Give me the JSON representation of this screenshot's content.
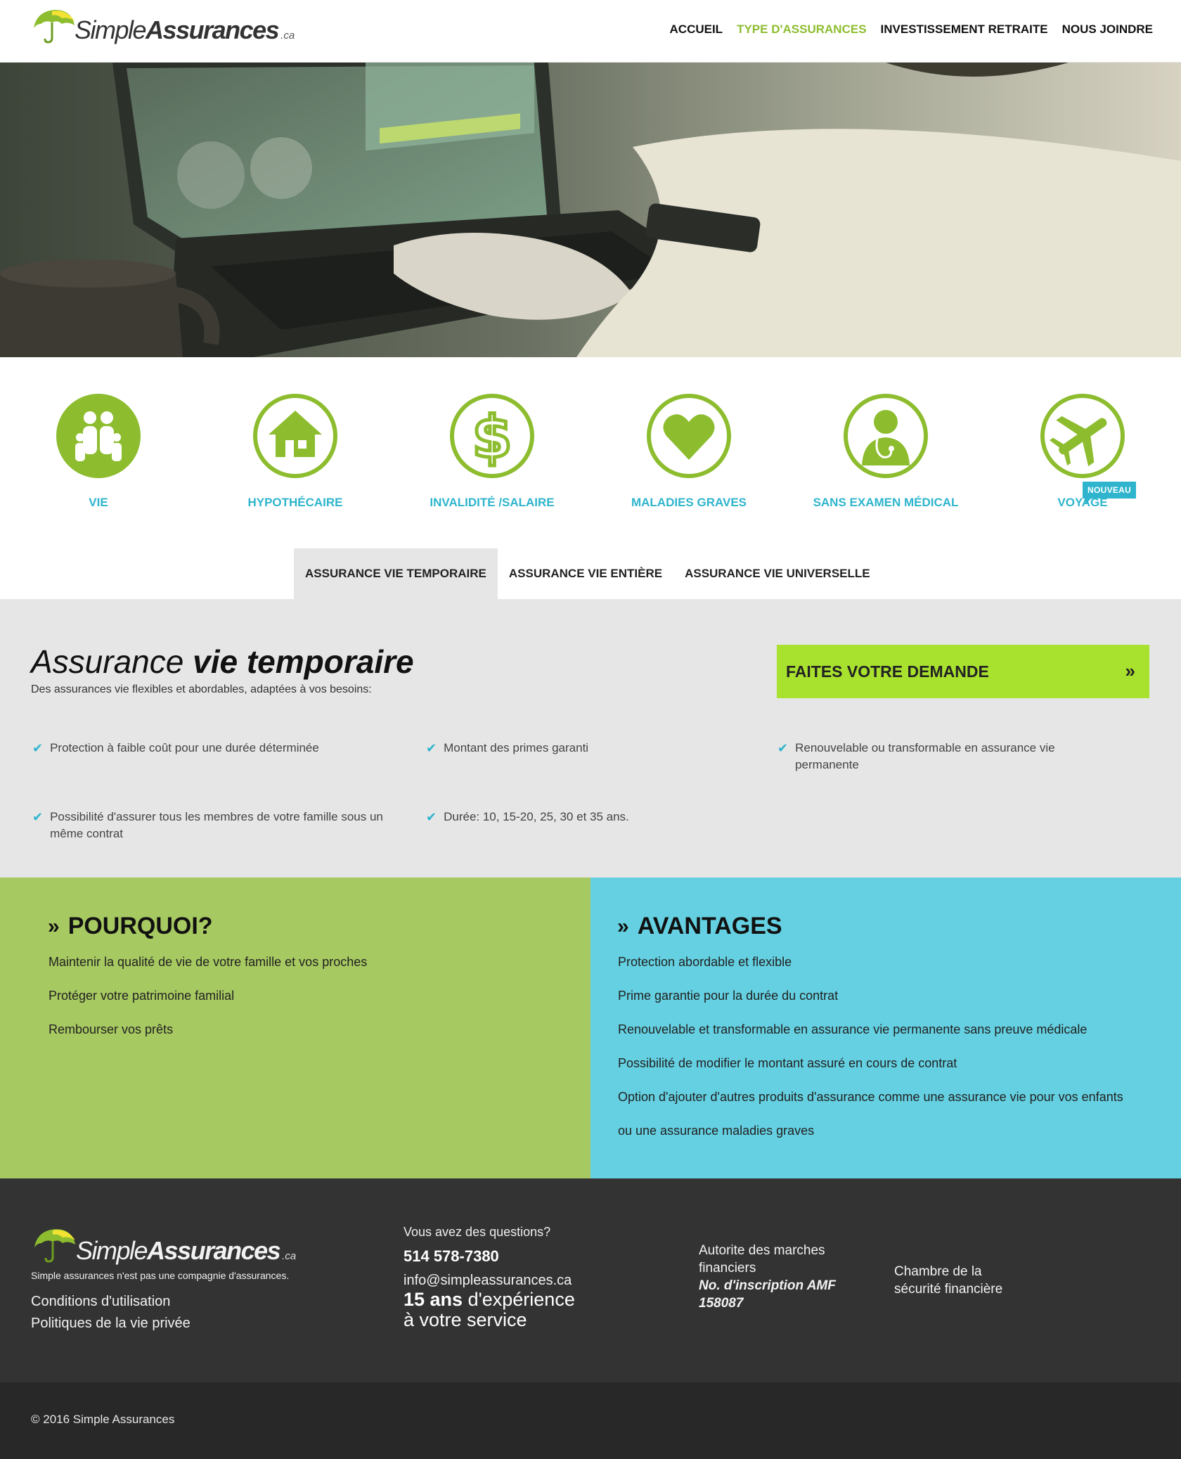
{
  "brand": {
    "simple": "Simple",
    "assurances": "Assurances",
    "tld": ".ca",
    "green": "#8dbd2f",
    "cyan": "#2eb5cd",
    "lime": "#a8e22f"
  },
  "nav": {
    "items": [
      {
        "label": "ACCUEIL"
      },
      {
        "label": "TYPE D'ASSURANCES"
      },
      {
        "label": "INVESTISSEMENT RETRAITE"
      },
      {
        "label": "NOUS JOINDRE"
      }
    ],
    "active": "TYPE D'ASSURANCES"
  },
  "hero": {
    "icon": "laptop-photo"
  },
  "categories": [
    {
      "label": "VIE",
      "icon": "family-icon"
    },
    {
      "label": "HYPOTHÉCAIRE",
      "icon": "house-icon"
    },
    {
      "label": "INVALIDITÉ /SALAIRE",
      "icon": "dollar-icon"
    },
    {
      "label": "MALADIES GRAVES",
      "icon": "heart-icon"
    },
    {
      "label": "SANS EXAMEN MÉDICAL",
      "icon": "doctor-icon"
    },
    {
      "label": "VOYAGE",
      "icon": "airplane-icon",
      "badge": "NOUVEAU"
    }
  ],
  "tabs": [
    {
      "label": "ASSURANCE VIE TEMPORAIRE",
      "active": true
    },
    {
      "label": "ASSURANCE VIE ENTIÈRE"
    },
    {
      "label": "ASSURANCE VIE UNIVERSELLE"
    }
  ],
  "panel": {
    "title_light": "Assurance",
    "title_bold": "vie temporaire",
    "subtitle": "Des assurances vie flexibles et abordables, adaptées à vos besoins:",
    "cta": "FAITES VOTRE DEMANDE",
    "cta_icon": "double-chevron-right-icon",
    "features": [
      "Protection à faible coût pour une durée déterminée",
      "Montant des primes garanti",
      "Renouvelable ou transformable en assurance vie permanente",
      "Possibilité d'assurer tous les membres de votre famille sous un même contrat",
      "Durée: 10, 15-20, 25, 30 et 35 ans."
    ]
  },
  "why": {
    "title": "POURQUOI?",
    "items": [
      "Maintenir la qualité de vie de votre famille et vos proches",
      "Protéger votre patrimoine familial",
      "Rembourser vos prêts"
    ]
  },
  "advantages": {
    "title": "AVANTAGES",
    "items": [
      "Protection abordable et flexible",
      "Prime garantie pour la durée du contrat",
      "Renouvelable et transformable en assurance vie permanente sans preuve médicale",
      "Possibilité de modifier le montant assuré en cours de contrat",
      "Option d'ajouter d'autres produits d'assurance comme une assurance vie pour vos enfants",
      "ou une assurance maladies graves"
    ]
  },
  "footer": {
    "tagline": "Simple assurances n'est pas une compagnie d'assurances.",
    "links": [
      "Conditions d'utilisation",
      "Politiques de la vie privée"
    ],
    "questions": "Vous avez des questions?",
    "phone": "514 578-7380",
    "email": "info@simpleassurances.ca",
    "experience_bold": "15 ans",
    "experience_rest": "d'expérience",
    "experience_line2": "à votre service",
    "amf_line1": "Autorite des marches",
    "amf_line2": "financiers",
    "amf_no": "No. d'inscription AMF",
    "amf_number": "158087",
    "csf_line1": "Chambre de la",
    "csf_line2": "sécurité financière",
    "copyright": "© 2016 Simple Assurances"
  }
}
